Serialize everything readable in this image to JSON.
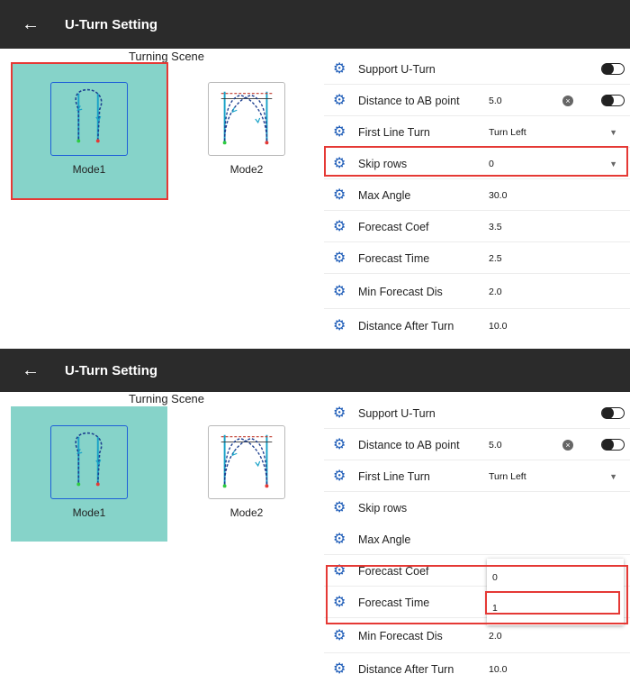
{
  "app": {
    "title": "U-Turn Setting",
    "back_icon": "back-arrow-icon"
  },
  "scene": {
    "title": "Turning Scene"
  },
  "modes": [
    {
      "label": "Mode1",
      "selected": true
    },
    {
      "label": "Mode2",
      "selected": false
    }
  ],
  "settings": {
    "support_uturn": {
      "label": "Support U-Turn",
      "toggle_on": false
    },
    "distance_ab": {
      "label": "Distance to AB point",
      "value": "5.0",
      "toggle_on": false
    },
    "first_line_turn": {
      "label": "First Line Turn",
      "value": "Turn Left"
    },
    "skip_rows": {
      "label": "Skip rows",
      "value": "0"
    },
    "max_angle": {
      "label": "Max Angle",
      "value": "30.0"
    },
    "forecast_coef": {
      "label": "Forecast Coef",
      "value": "3.5"
    },
    "forecast_time": {
      "label": "Forecast Time",
      "value": "2.5"
    },
    "min_forecast_dis": {
      "label": "Min Forecast Dis",
      "value": "2.0"
    },
    "distance_after_turn": {
      "label": "Distance After Turn",
      "value": "10.0"
    }
  },
  "skip_rows_dropdown": {
    "options": [
      "0",
      "1"
    ],
    "highlighted_option": "1"
  },
  "colors": {
    "appbar": "#2b2b2b",
    "mode_selected_bg": "#86d3c9",
    "mode_frame_selected": "#1e5fd8",
    "gear": "#1f5db8",
    "annotation_red": "#e53935",
    "value_highlight": "#cde8e1"
  }
}
